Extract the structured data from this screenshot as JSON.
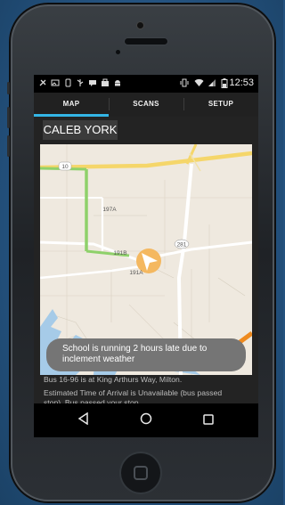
{
  "status_bar": {
    "time": "12:53",
    "icons": [
      "settings-icon",
      "image-icon",
      "phone-icon",
      "usb-icon",
      "message-icon",
      "shopping-icon",
      "android-icon",
      "vibrate-icon",
      "wifi-icon",
      "signal-icon",
      "battery-icon"
    ]
  },
  "tabs": [
    {
      "label": "MAP",
      "selected": true
    },
    {
      "label": "SCANS",
      "selected": false
    },
    {
      "label": "SETUP",
      "selected": false
    }
  ],
  "student_name": "CALEB YORK",
  "map": {
    "road_labels": {
      "r10": "10",
      "r197a": "197A",
      "r191b": "191B",
      "r191a": "191A",
      "r281": "281"
    }
  },
  "toast": {
    "line1": "School is running 2 hours late due to",
    "line2": "inclement weather"
  },
  "info": {
    "bus_location": "Bus 16-96 is at King Arthurs Way, Milton.",
    "eta_line1": "Estimated Time of Arrival is Unavailable (bus passed",
    "eta_line2": "stop). Bus passed your stop."
  },
  "colors": {
    "accent": "#33b5e5",
    "marker": "#f4b860",
    "school_zone": "#8fd16b",
    "highway": "#f5d66a",
    "water": "#a6cbe8"
  },
  "navbar": {
    "back_icon": "back-icon",
    "home_icon": "home-icon",
    "recents_icon": "recents-icon"
  }
}
